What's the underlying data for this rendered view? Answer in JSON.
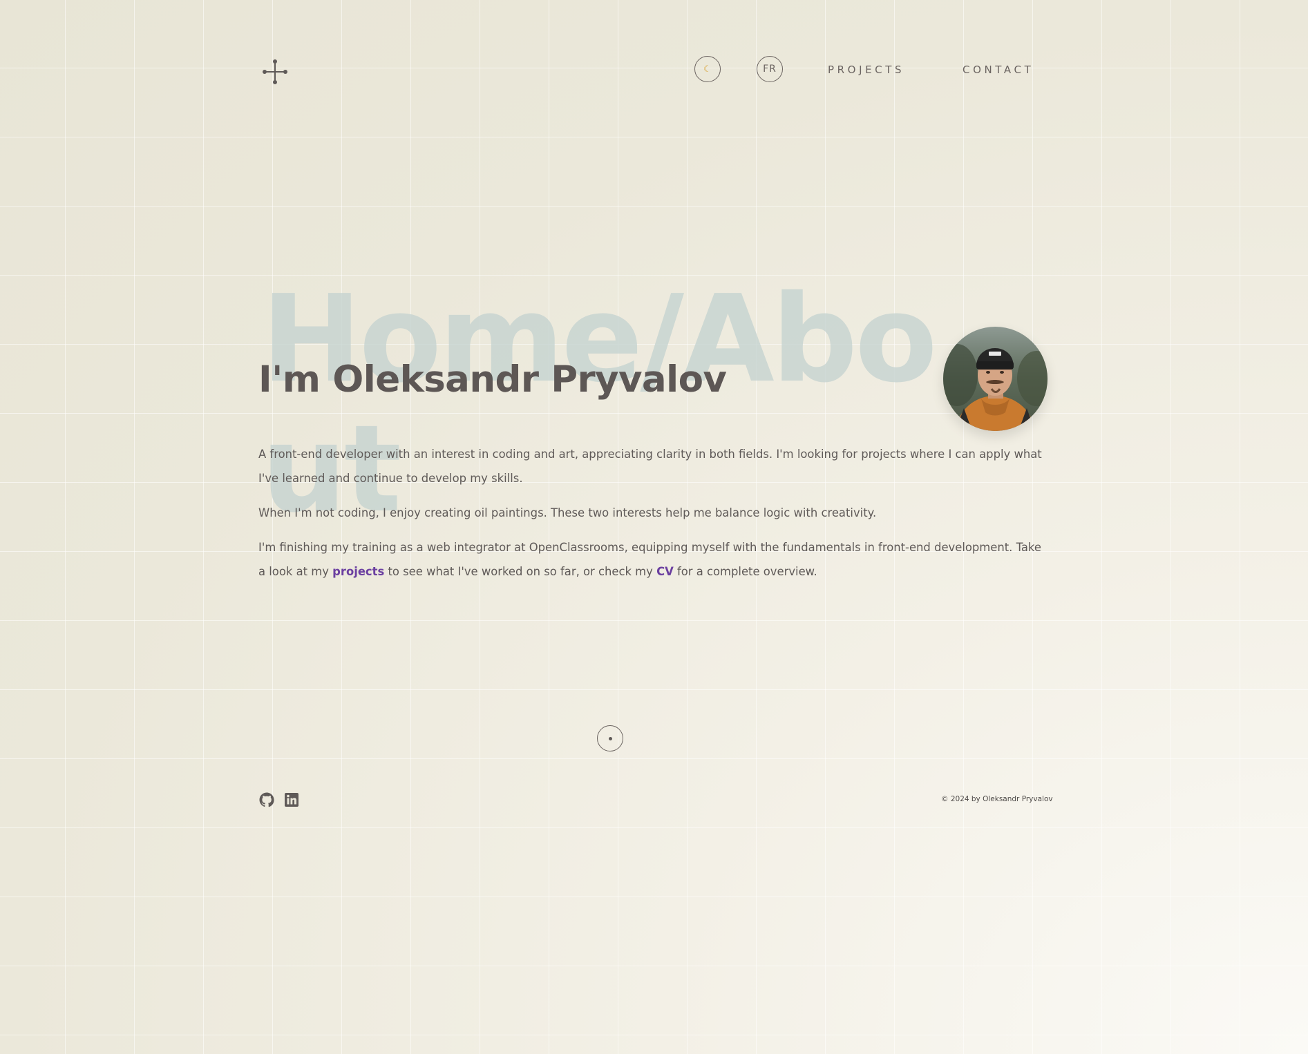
{
  "header": {
    "theme_toggle_icon": "crescent-moon-icon",
    "lang_toggle_label": "FR",
    "nav": {
      "projects_label": "PROJECTS",
      "contact_label": "CONTACT"
    }
  },
  "hero": {
    "background_title": "Home/About",
    "name": "I'm Oleksandr Pryvalov",
    "avatar": "profile-photo"
  },
  "bio": {
    "p1": "A front-end developer with an interest in coding and art, appreciating clarity in both fields. I'm looking for projects where I can apply what I've learned and continue to develop my skills.",
    "p2": "When I'm not coding, I enjoy creating oil paintings. These two interests help me balance logic with creativity.",
    "p3_before": "I'm finishing my training as a web integrator at OpenClassrooms, equipping myself with the fundamentals in front-end development. Take a look at my ",
    "p3_link_projects": "projects",
    "p3_middle": " to see what I've worked on so far, or check my ",
    "p3_link_cv": "CV",
    "p3_after": " for a complete overview."
  },
  "footer": {
    "copyright": "© 2024 by Oleksandr Pryvalov",
    "social_icons": [
      "github-icon",
      "linkedin-icon"
    ]
  },
  "colors": {
    "text": "#5f5a58",
    "link": "#6b3fa0",
    "ghost_title": "#c4d2d0",
    "moon": "#d9a63b"
  }
}
